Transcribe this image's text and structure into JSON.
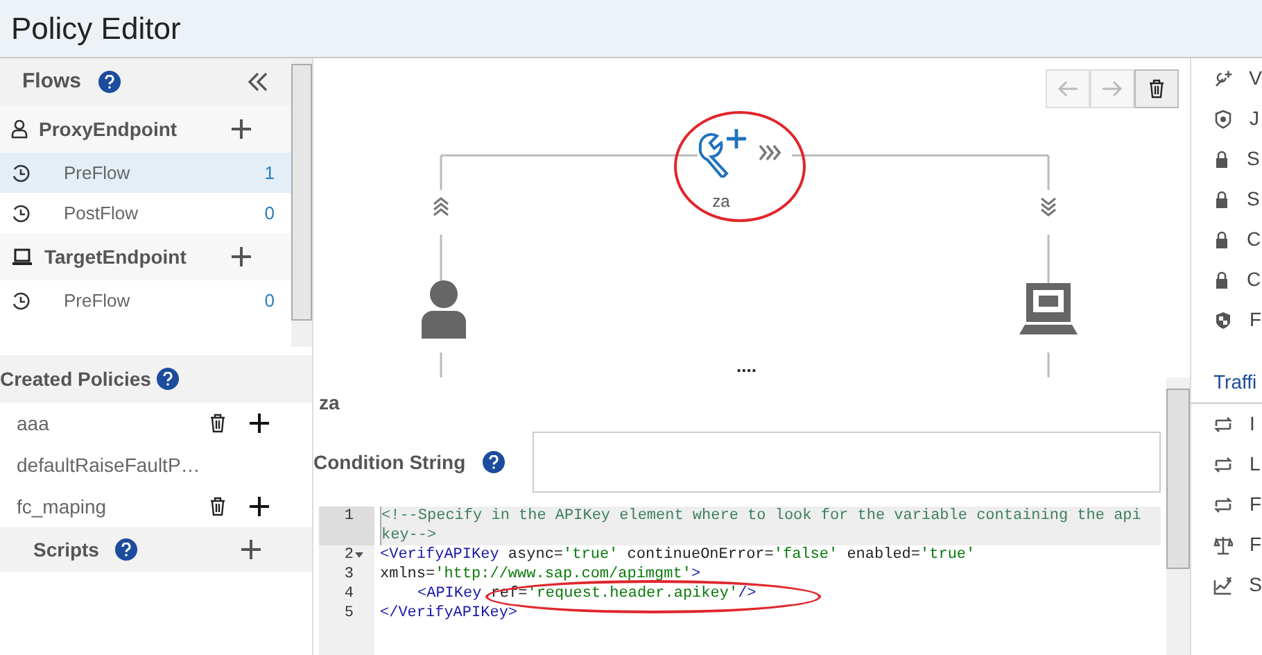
{
  "header": {
    "title": "Policy Editor"
  },
  "flows": {
    "title": "Flows",
    "groups": [
      {
        "kind": "proxy",
        "label": "ProxyEndpoint",
        "items": [
          {
            "label": "PreFlow",
            "count": "1",
            "selected": true
          },
          {
            "label": "PostFlow",
            "count": "0",
            "selected": false
          }
        ]
      },
      {
        "kind": "target",
        "label": "TargetEndpoint",
        "items": [
          {
            "label": "PreFlow",
            "count": "0",
            "selected": false
          }
        ]
      }
    ]
  },
  "created_policies": {
    "title": "Created Policies",
    "items": [
      {
        "label": "aaa",
        "deletable": true
      },
      {
        "label": "defaultRaiseFaultP…",
        "deletable": false
      },
      {
        "label": "fc_maping",
        "deletable": true
      }
    ]
  },
  "scripts": {
    "title": "Scripts"
  },
  "canvas": {
    "policy_label": "za",
    "more": "...."
  },
  "details": {
    "name": "za",
    "condition_label": "Condition String",
    "code": [
      {
        "number": "1",
        "wrap": true,
        "fold": false,
        "indent": false,
        "segments": [
          {
            "kind": "comment",
            "text": "<!--Specify in the APIKey element where to look for the variable containing the api key-->"
          }
        ]
      },
      {
        "number": "2",
        "wrap": false,
        "fold": true,
        "indent": false,
        "segments": [
          {
            "kind": "tag",
            "text": "<VerifyAPIKey"
          },
          {
            "kind": "attr",
            "text": " async="
          },
          {
            "kind": "value",
            "text": "'true'"
          },
          {
            "kind": "attr",
            "text": " continueOnError="
          },
          {
            "kind": "value",
            "text": "'false'"
          },
          {
            "kind": "attr",
            "text": " enabled="
          },
          {
            "kind": "value",
            "text": "'true'"
          }
        ]
      },
      {
        "number": "3",
        "wrap": false,
        "fold": false,
        "indent": false,
        "segments": [
          {
            "kind": "attr",
            "text": "xmlns="
          },
          {
            "kind": "value",
            "text": "'http://www.sap.com/apimgmt'"
          },
          {
            "kind": "tag",
            "text": ">"
          }
        ]
      },
      {
        "number": "4",
        "wrap": false,
        "fold": false,
        "indent": true,
        "segments": [
          {
            "kind": "tag",
            "text": "<APIKey"
          },
          {
            "kind": "attr",
            "text": " ref="
          },
          {
            "kind": "value",
            "text": "'request.header.apikey'"
          },
          {
            "kind": "tag",
            "text": "/>"
          }
        ]
      },
      {
        "number": "5",
        "wrap": false,
        "fold": false,
        "indent": false,
        "segments": [
          {
            "kind": "tag",
            "text": "</VerifyAPIKey>"
          }
        ]
      }
    ]
  },
  "palette": {
    "items": [
      {
        "kind": "wrench",
        "label": "V"
      },
      {
        "kind": "badge",
        "label": "J"
      },
      {
        "kind": "lock",
        "label": "S"
      },
      {
        "kind": "lock",
        "label": "S"
      },
      {
        "kind": "lock",
        "label": "C"
      },
      {
        "kind": "lock",
        "label": "C"
      },
      {
        "kind": "shield",
        "label": "F"
      }
    ],
    "section": "Traffi",
    "items2": [
      {
        "kind": "swap",
        "label": "I"
      },
      {
        "kind": "swap",
        "label": "L"
      },
      {
        "kind": "swap",
        "label": "F"
      },
      {
        "kind": "scale",
        "label": "F"
      },
      {
        "kind": "chart",
        "label": "S"
      }
    ]
  }
}
